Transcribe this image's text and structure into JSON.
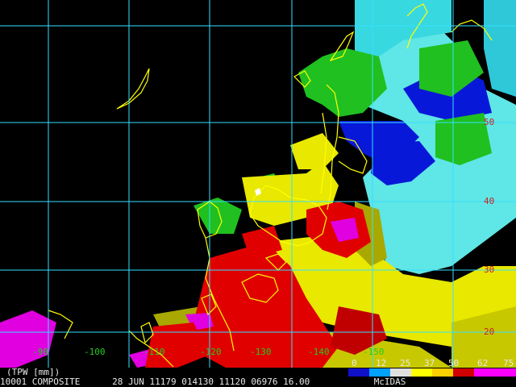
{
  "product_label": "(TPW [mm])",
  "status": {
    "frame": "1",
    "product_id": "0001",
    "source": "COMPOSITE",
    "date": "28 JUN 11179",
    "time": "014130",
    "sat_info": "11120 06976",
    "res": "16.00",
    "brand": "McIDAS"
  },
  "lat_labels": [
    "50",
    "40",
    "30",
    "20"
  ],
  "lon_labels": [
    "-90",
    "-100",
    "-110",
    "-120",
    "-130",
    "-140",
    "-150"
  ],
  "scale": {
    "ticks": [
      "0",
      "12",
      "25",
      "37",
      "50",
      "62",
      "75"
    ],
    "colors": [
      "#1010c8",
      "#00a0ff",
      "#e0e0e0",
      "#ffff00",
      "#ffd000",
      "#d00000",
      "#ff00ff",
      "#ff00ff"
    ]
  },
  "colors": {
    "background": "#000000",
    "grid": "#33e0ff",
    "coast": "#ffff00",
    "tpw_cyan": "#38e0e8",
    "tpw_blue": "#0818d8",
    "tpw_green": "#20c020",
    "tpw_yellow": "#e0e000",
    "tpw_olive": "#a8a800",
    "tpw_red": "#e00000",
    "tpw_magenta": "#e000e0"
  }
}
